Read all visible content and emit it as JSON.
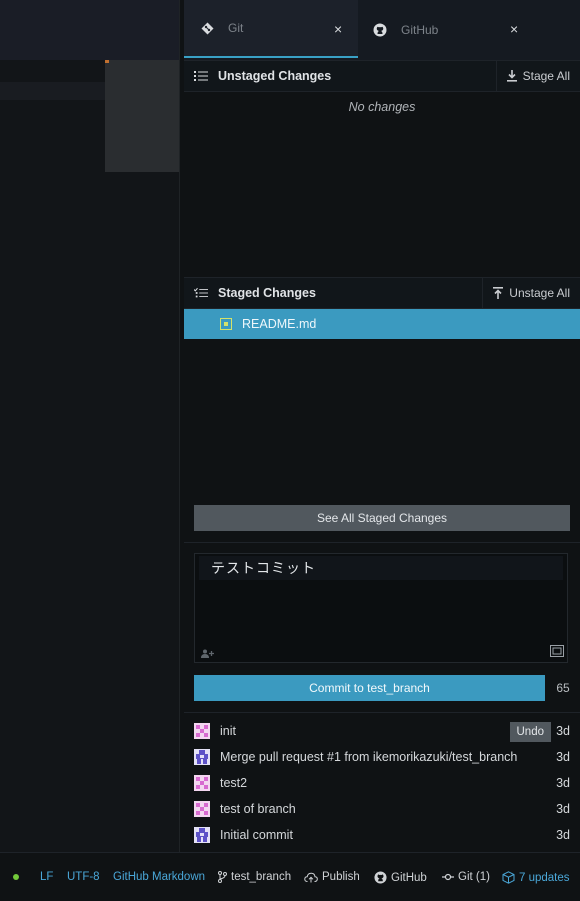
{
  "tabs": [
    {
      "label": "Git",
      "icon": "git-icon",
      "close": "×"
    },
    {
      "label": "GitHub",
      "icon": "github-icon",
      "close": "×"
    }
  ],
  "unstaged": {
    "title": "Unstaged Changes",
    "action": "Stage All",
    "empty_text": "No changes"
  },
  "staged": {
    "title": "Staged Changes",
    "action": "Unstage All",
    "files": [
      {
        "name": "README.md",
        "status": "modified"
      }
    ],
    "see_all_label": "See All Staged Changes"
  },
  "commit": {
    "message": "テストコミット",
    "button_label": "Commit to test_branch",
    "char_count": "65"
  },
  "recent_commits": [
    {
      "message": "init",
      "age": "3d",
      "avatar": "pink",
      "undo": "Undo"
    },
    {
      "message": "Merge pull request #1 from ikemorikazuki/test_branch",
      "age": "3d",
      "avatar": "purple"
    },
    {
      "message": "test2",
      "age": "3d",
      "avatar": "pink"
    },
    {
      "message": "test of branch",
      "age": "3d",
      "avatar": "pink"
    },
    {
      "message": "Initial commit",
      "age": "3d",
      "avatar": "purple"
    }
  ],
  "statusbar": {
    "line_ending": "LF",
    "encoding": "UTF-8",
    "grammar": "GitHub Markdown",
    "branch": "test_branch",
    "publish": "Publish",
    "github": "GitHub",
    "git": "Git (1)",
    "updates": "7 updates"
  },
  "colors": {
    "accent": "#3b9ac0",
    "status_dot": "#73c93a",
    "link": "#4aa7d8"
  }
}
